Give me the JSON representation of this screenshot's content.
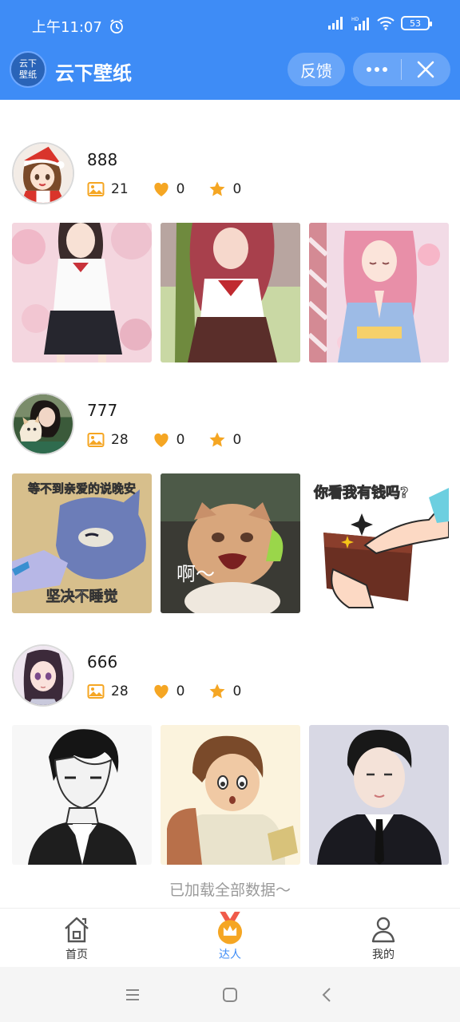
{
  "status_bar": {
    "time": "上午11:07",
    "battery": "53",
    "network": "HD"
  },
  "header": {
    "logo_text": "云下\n壁纸",
    "title": "云下壁纸",
    "feedback_label": "反馈"
  },
  "users": [
    {
      "name": "888",
      "images_count": "21",
      "likes_count": "0",
      "favorites_count": "0",
      "thumbnails": [
        {
          "icon": "anime-girl-sailor-cherry-blossom"
        },
        {
          "icon": "anime-girl-red-hair-sailor"
        },
        {
          "icon": "anime-girl-pink-kimono-praying"
        }
      ]
    },
    {
      "name": "777",
      "images_count": "28",
      "likes_count": "0",
      "favorites_count": "0",
      "thumbnails": [
        {
          "icon": "tom-cat-meme",
          "top_text": "等不到亲爱的说晚安",
          "bottom_text": "坚决不睡觉"
        },
        {
          "icon": "angry-cat-meme",
          "text": "啊～"
        },
        {
          "icon": "wallet-meme",
          "text": "你看我有钱吗?"
        }
      ]
    },
    {
      "name": "666",
      "images_count": "28",
      "likes_count": "0",
      "favorites_count": "0",
      "thumbnails": [
        {
          "icon": "manga-boy-sketch"
        },
        {
          "icon": "cartoon-boy-backpack"
        },
        {
          "icon": "anime-boy-suit"
        }
      ]
    }
  ],
  "footer_text": "已加载全部数据～",
  "tabs": [
    {
      "label": "首页",
      "icon": "home-icon"
    },
    {
      "label": "达人",
      "icon": "crown-medal-icon",
      "active": true
    },
    {
      "label": "我的",
      "icon": "user-icon"
    }
  ],
  "colors": {
    "primary": "#3e8cf6",
    "stat_orange": "#f5a623",
    "muted": "#9a9a9a"
  }
}
